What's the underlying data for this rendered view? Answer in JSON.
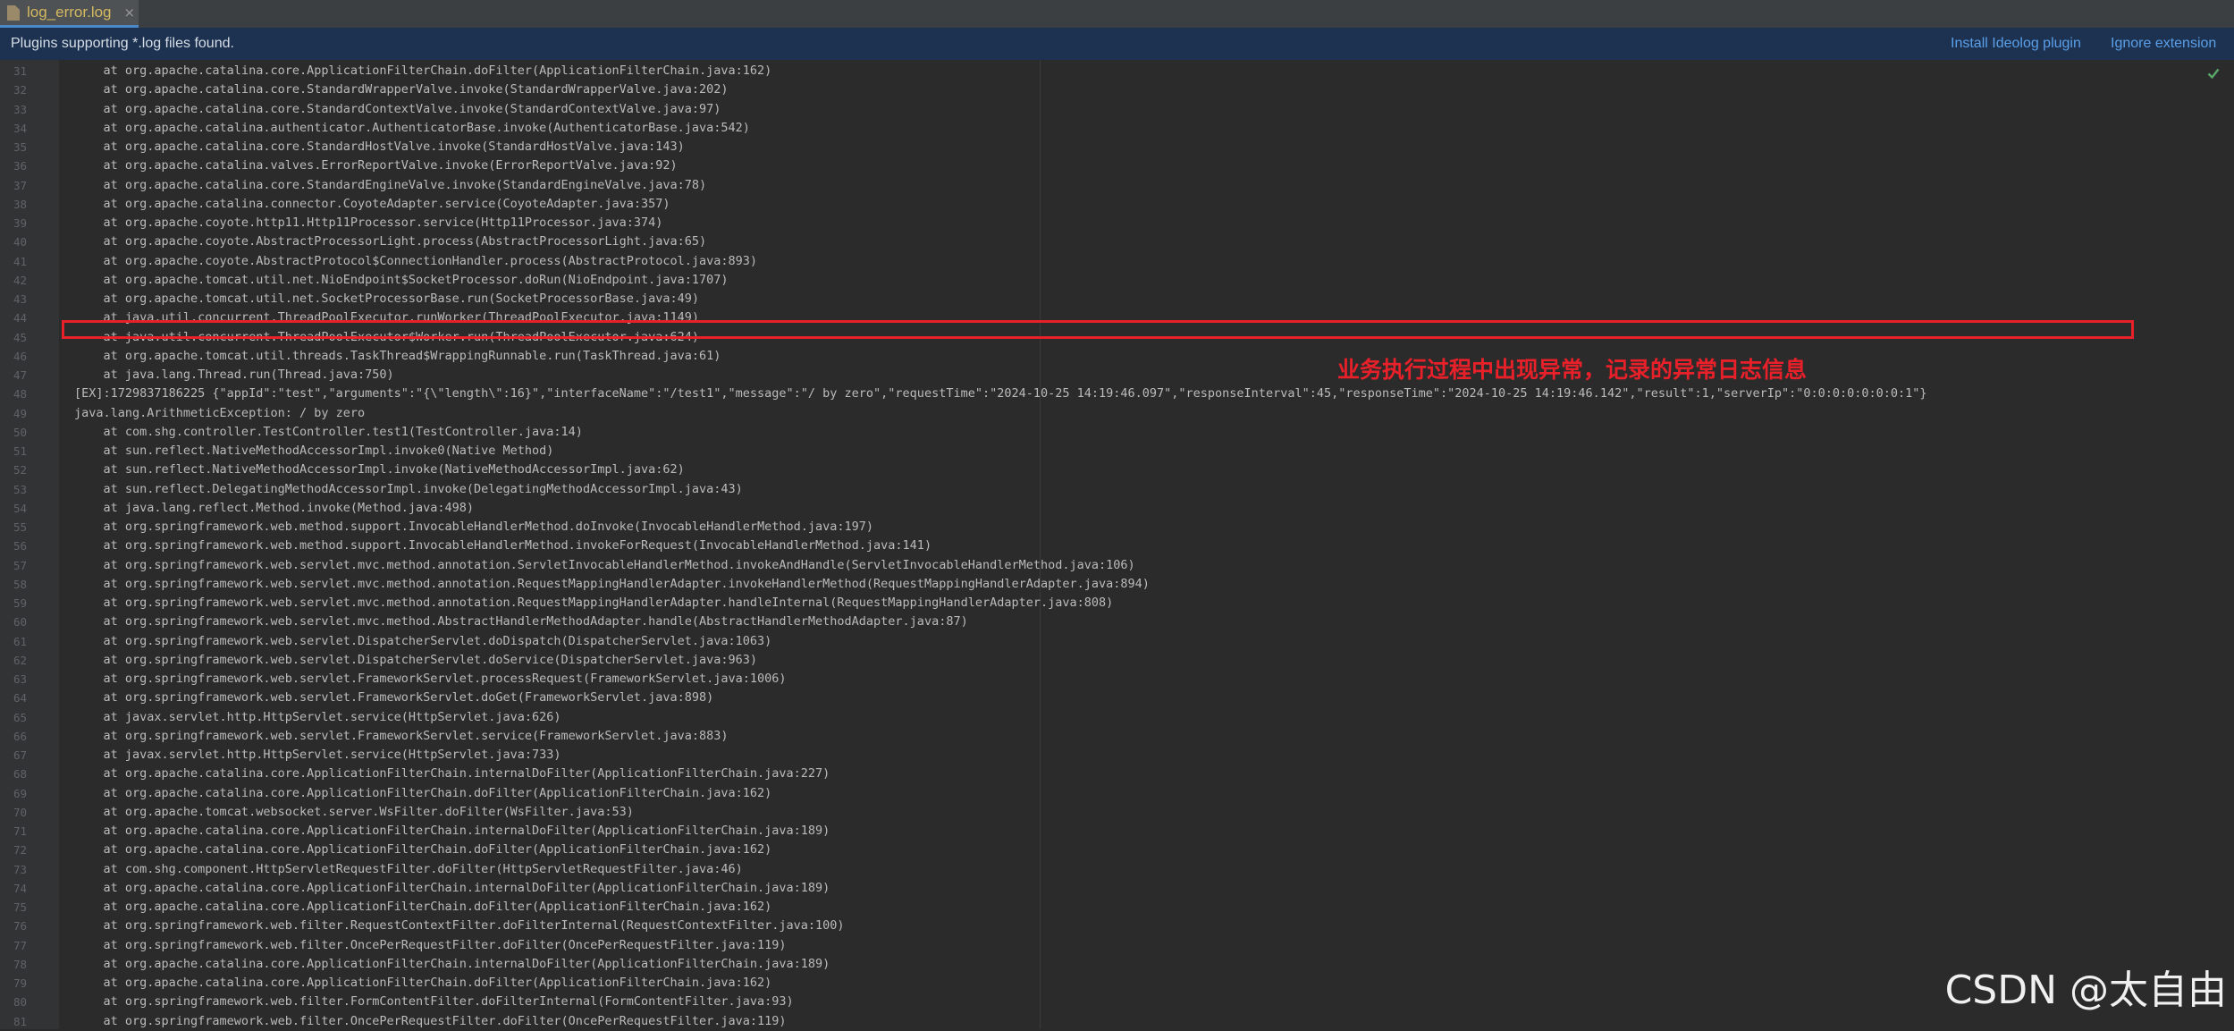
{
  "tab": {
    "label": "log_error.log",
    "close": "×",
    "file_icon": "log-file-icon"
  },
  "notice": {
    "text": "Plugins supporting *.log files found.",
    "install_link": "Install Ideolog plugin",
    "ignore_link": "Ignore extension"
  },
  "editor": {
    "lines": [
      {
        "n": "31",
        "t": "    at org.apache.catalina.core.ApplicationFilterChain.doFilter(ApplicationFilterChain.java:162)"
      },
      {
        "n": "32",
        "t": "    at org.apache.catalina.core.StandardWrapperValve.invoke(StandardWrapperValve.java:202)"
      },
      {
        "n": "33",
        "t": "    at org.apache.catalina.core.StandardContextValve.invoke(StandardContextValve.java:97)"
      },
      {
        "n": "34",
        "t": "    at org.apache.catalina.authenticator.AuthenticatorBase.invoke(AuthenticatorBase.java:542)"
      },
      {
        "n": "35",
        "t": "    at org.apache.catalina.core.StandardHostValve.invoke(StandardHostValve.java:143)"
      },
      {
        "n": "36",
        "t": "    at org.apache.catalina.valves.ErrorReportValve.invoke(ErrorReportValve.java:92)"
      },
      {
        "n": "37",
        "t": "    at org.apache.catalina.core.StandardEngineValve.invoke(StandardEngineValve.java:78)"
      },
      {
        "n": "38",
        "t": "    at org.apache.catalina.connector.CoyoteAdapter.service(CoyoteAdapter.java:357)"
      },
      {
        "n": "39",
        "t": "    at org.apache.coyote.http11.Http11Processor.service(Http11Processor.java:374)"
      },
      {
        "n": "40",
        "t": "    at org.apache.coyote.AbstractProcessorLight.process(AbstractProcessorLight.java:65)"
      },
      {
        "n": "41",
        "t": "    at org.apache.coyote.AbstractProtocol$ConnectionHandler.process(AbstractProtocol.java:893)"
      },
      {
        "n": "42",
        "t": "    at org.apache.tomcat.util.net.NioEndpoint$SocketProcessor.doRun(NioEndpoint.java:1707)"
      },
      {
        "n": "43",
        "t": "    at org.apache.tomcat.util.net.SocketProcessorBase.run(SocketProcessorBase.java:49)"
      },
      {
        "n": "44",
        "t": "    at java.util.concurrent.ThreadPoolExecutor.runWorker(ThreadPoolExecutor.java:1149)"
      },
      {
        "n": "45",
        "t": "    at java.util.concurrent.ThreadPoolExecutor$Worker.run(ThreadPoolExecutor.java:624)"
      },
      {
        "n": "46",
        "t": "    at org.apache.tomcat.util.threads.TaskThread$WrappingRunnable.run(TaskThread.java:61)"
      },
      {
        "n": "47",
        "t": "    at java.lang.Thread.run(Thread.java:750)"
      },
      {
        "n": "48",
        "t": "[EX]:1729837186225 {\"appId\":\"test\",\"arguments\":\"{\\\"length\\\":16}\",\"interfaceName\":\"/test1\",\"message\":\"/ by zero\",\"requestTime\":\"2024-10-25 14:19:46.097\",\"responseInterval\":45,\"responseTime\":\"2024-10-25 14:19:46.142\",\"result\":1,\"serverIp\":\"0:0:0:0:0:0:0:1\"}"
      },
      {
        "n": "49",
        "t": "java.lang.ArithmeticException: / by zero"
      },
      {
        "n": "50",
        "t": "    at com.shg.controller.TestController.test1(TestController.java:14)"
      },
      {
        "n": "51",
        "t": "    at sun.reflect.NativeMethodAccessorImpl.invoke0(Native Method)"
      },
      {
        "n": "52",
        "t": "    at sun.reflect.NativeMethodAccessorImpl.invoke(NativeMethodAccessorImpl.java:62)"
      },
      {
        "n": "53",
        "t": "    at sun.reflect.DelegatingMethodAccessorImpl.invoke(DelegatingMethodAccessorImpl.java:43)"
      },
      {
        "n": "54",
        "t": "    at java.lang.reflect.Method.invoke(Method.java:498)"
      },
      {
        "n": "55",
        "t": "    at org.springframework.web.method.support.InvocableHandlerMethod.doInvoke(InvocableHandlerMethod.java:197)"
      },
      {
        "n": "56",
        "t": "    at org.springframework.web.method.support.InvocableHandlerMethod.invokeForRequest(InvocableHandlerMethod.java:141)"
      },
      {
        "n": "57",
        "t": "    at org.springframework.web.servlet.mvc.method.annotation.ServletInvocableHandlerMethod.invokeAndHandle(ServletInvocableHandlerMethod.java:106)"
      },
      {
        "n": "58",
        "t": "    at org.springframework.web.servlet.mvc.method.annotation.RequestMappingHandlerAdapter.invokeHandlerMethod(RequestMappingHandlerAdapter.java:894)"
      },
      {
        "n": "59",
        "t": "    at org.springframework.web.servlet.mvc.method.annotation.RequestMappingHandlerAdapter.handleInternal(RequestMappingHandlerAdapter.java:808)"
      },
      {
        "n": "60",
        "t": "    at org.springframework.web.servlet.mvc.method.AbstractHandlerMethodAdapter.handle(AbstractHandlerMethodAdapter.java:87)"
      },
      {
        "n": "61",
        "t": "    at org.springframework.web.servlet.DispatcherServlet.doDispatch(DispatcherServlet.java:1063)"
      },
      {
        "n": "62",
        "t": "    at org.springframework.web.servlet.DispatcherServlet.doService(DispatcherServlet.java:963)"
      },
      {
        "n": "63",
        "t": "    at org.springframework.web.servlet.FrameworkServlet.processRequest(FrameworkServlet.java:1006)"
      },
      {
        "n": "64",
        "t": "    at org.springframework.web.servlet.FrameworkServlet.doGet(FrameworkServlet.java:898)"
      },
      {
        "n": "65",
        "t": "    at javax.servlet.http.HttpServlet.service(HttpServlet.java:626)"
      },
      {
        "n": "66",
        "t": "    at org.springframework.web.servlet.FrameworkServlet.service(FrameworkServlet.java:883)"
      },
      {
        "n": "67",
        "t": "    at javax.servlet.http.HttpServlet.service(HttpServlet.java:733)"
      },
      {
        "n": "68",
        "t": "    at org.apache.catalina.core.ApplicationFilterChain.internalDoFilter(ApplicationFilterChain.java:227)"
      },
      {
        "n": "69",
        "t": "    at org.apache.catalina.core.ApplicationFilterChain.doFilter(ApplicationFilterChain.java:162)"
      },
      {
        "n": "70",
        "t": "    at org.apache.tomcat.websocket.server.WsFilter.doFilter(WsFilter.java:53)"
      },
      {
        "n": "71",
        "t": "    at org.apache.catalina.core.ApplicationFilterChain.internalDoFilter(ApplicationFilterChain.java:189)"
      },
      {
        "n": "72",
        "t": "    at org.apache.catalina.core.ApplicationFilterChain.doFilter(ApplicationFilterChain.java:162)"
      },
      {
        "n": "73",
        "t": "    at com.shg.component.HttpServletRequestFilter.doFilter(HttpServletRequestFilter.java:46)"
      },
      {
        "n": "74",
        "t": "    at org.apache.catalina.core.ApplicationFilterChain.internalDoFilter(ApplicationFilterChain.java:189)"
      },
      {
        "n": "75",
        "t": "    at org.apache.catalina.core.ApplicationFilterChain.doFilter(ApplicationFilterChain.java:162)"
      },
      {
        "n": "76",
        "t": "    at org.springframework.web.filter.RequestContextFilter.doFilterInternal(RequestContextFilter.java:100)"
      },
      {
        "n": "77",
        "t": "    at org.springframework.web.filter.OncePerRequestFilter.doFilter(OncePerRequestFilter.java:119)"
      },
      {
        "n": "78",
        "t": "    at org.apache.catalina.core.ApplicationFilterChain.internalDoFilter(ApplicationFilterChain.java:189)"
      },
      {
        "n": "79",
        "t": "    at org.apache.catalina.core.ApplicationFilterChain.doFilter(ApplicationFilterChain.java:162)"
      },
      {
        "n": "80",
        "t": "    at org.springframework.web.filter.FormContentFilter.doFilterInternal(FormContentFilter.java:93)"
      },
      {
        "n": "81",
        "t": "    at org.springframework.web.filter.OncePerRequestFilter.doFilter(OncePerRequestFilter.java:119)"
      }
    ]
  },
  "annotation": {
    "text": "业务执行过程中出现异常，记录的异常日志信息",
    "color": "#e8202a"
  },
  "status": {
    "check_icon": "check-icon"
  },
  "watermark": {
    "text": "CSDN @太自由"
  }
}
